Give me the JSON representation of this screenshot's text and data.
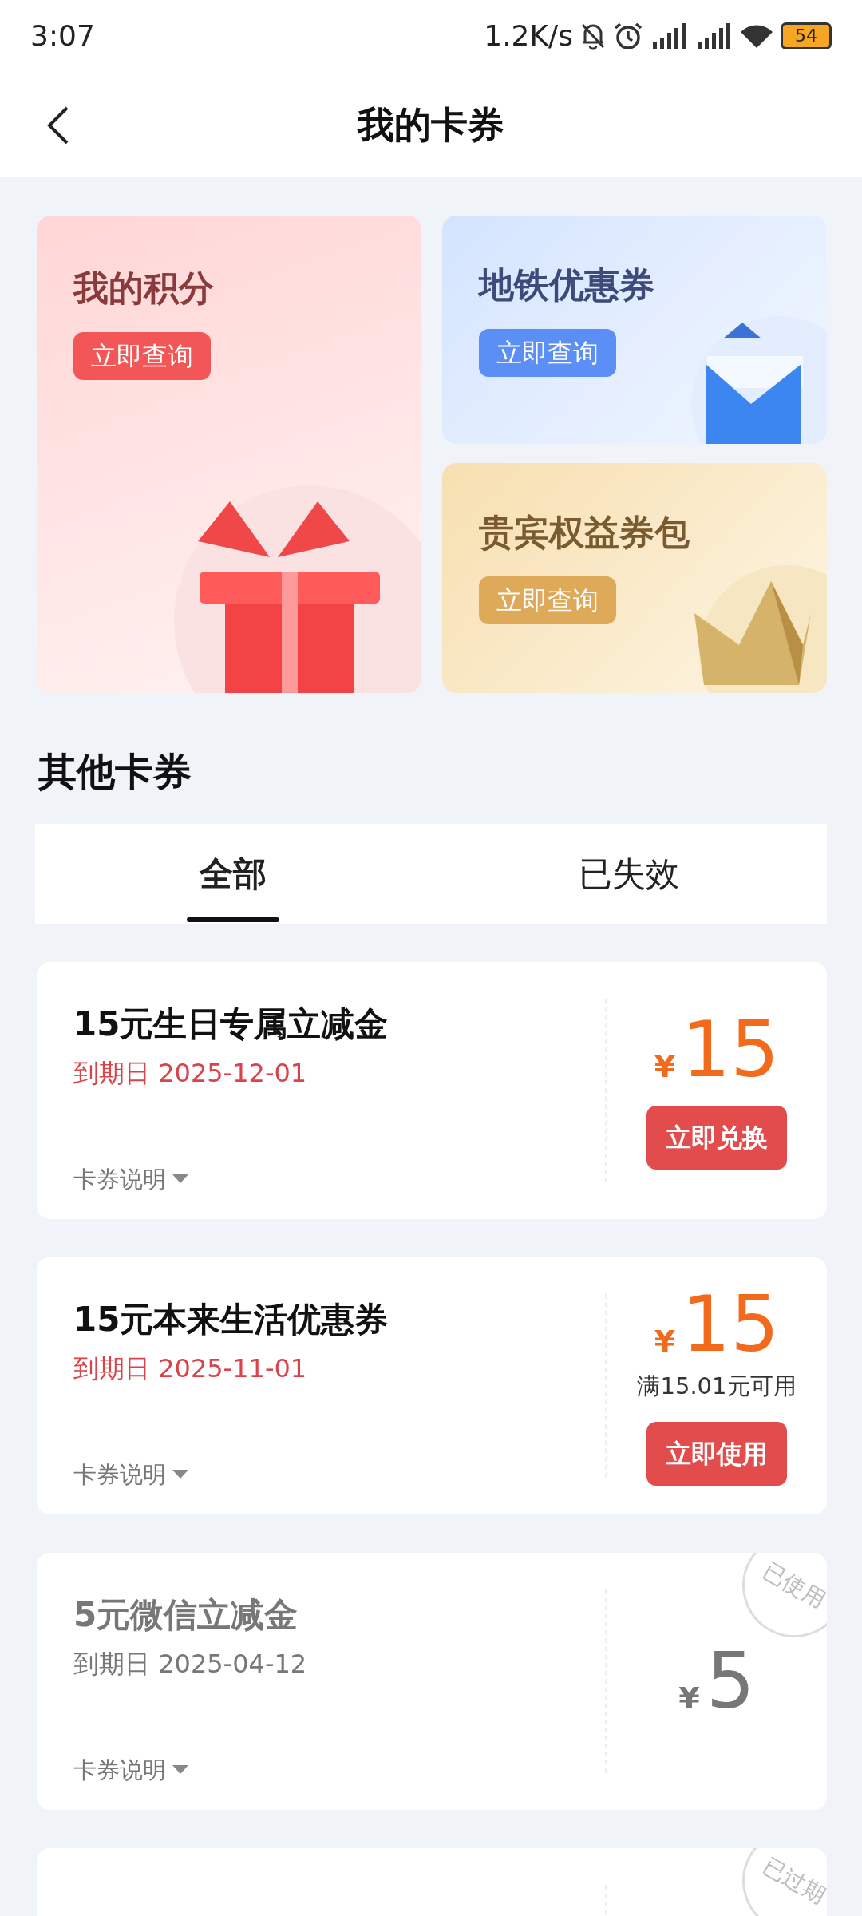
{
  "status_bar": {
    "time": "3:07",
    "speed": "1.2K/s",
    "battery": "54"
  },
  "header": {
    "title": "我的卡券"
  },
  "promo_cards": [
    {
      "kind": "points",
      "title": "我的积分",
      "button": "立即查询"
    },
    {
      "kind": "metro",
      "title": "地铁优惠券",
      "button": "立即查询"
    },
    {
      "kind": "vip",
      "title": "贵宾权益券包",
      "button": "立即查询"
    }
  ],
  "section_title": "其他卡券",
  "tabs": [
    {
      "label": "全部",
      "selected": true
    },
    {
      "label": "已失效",
      "selected": false
    }
  ],
  "coupons": [
    {
      "title": "15元生日专属立减金",
      "expiry": "到期日 2025-12-01",
      "details": "卡券说明",
      "currency": "¥",
      "amount": "15",
      "button": "立即兑换",
      "disabled": false
    },
    {
      "title": "15元本来生活优惠券",
      "expiry": "到期日 2025-11-01",
      "details": "卡券说明",
      "currency": "¥",
      "amount": "15",
      "condition": "满15.01元可用",
      "button": "立即使用",
      "disabled": false
    },
    {
      "title": "5元微信立减金",
      "expiry": "到期日 2025-04-12",
      "details": "卡券说明",
      "currency": "¥",
      "amount": "5",
      "stamp": "已使用",
      "disabled": true
    },
    {
      "stamp": "已过期",
      "disabled": true
    }
  ]
}
